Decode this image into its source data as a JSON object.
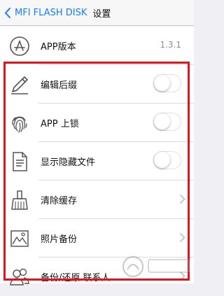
{
  "nav": {
    "back_label": "MFI FLASH DISK",
    "title": "设置"
  },
  "rows": [
    {
      "label": "APP版本",
      "value": "1.3.1",
      "control": "value",
      "icon": "app-store-icon"
    },
    {
      "label": "编辑后缀",
      "control": "toggle",
      "toggle_on": false,
      "icon": "pencil-icon"
    },
    {
      "label": "APP 上锁",
      "control": "toggle",
      "toggle_on": false,
      "icon": "fingerprint-icon"
    },
    {
      "label": "显示隐藏文件",
      "control": "toggle",
      "toggle_on": false,
      "icon": "document-icon"
    },
    {
      "label": "清除缓存",
      "control": "chevron",
      "icon": "broom-icon"
    },
    {
      "label": "照片备份",
      "control": "chevron",
      "icon": "photo-icon"
    },
    {
      "label": "备份/还原 联系人",
      "control": "chevron",
      "icon": "contacts-icon"
    }
  ],
  "colors": {
    "accent": "#157efb",
    "highlight_border": "#e3141c",
    "background": "#efeff4"
  }
}
